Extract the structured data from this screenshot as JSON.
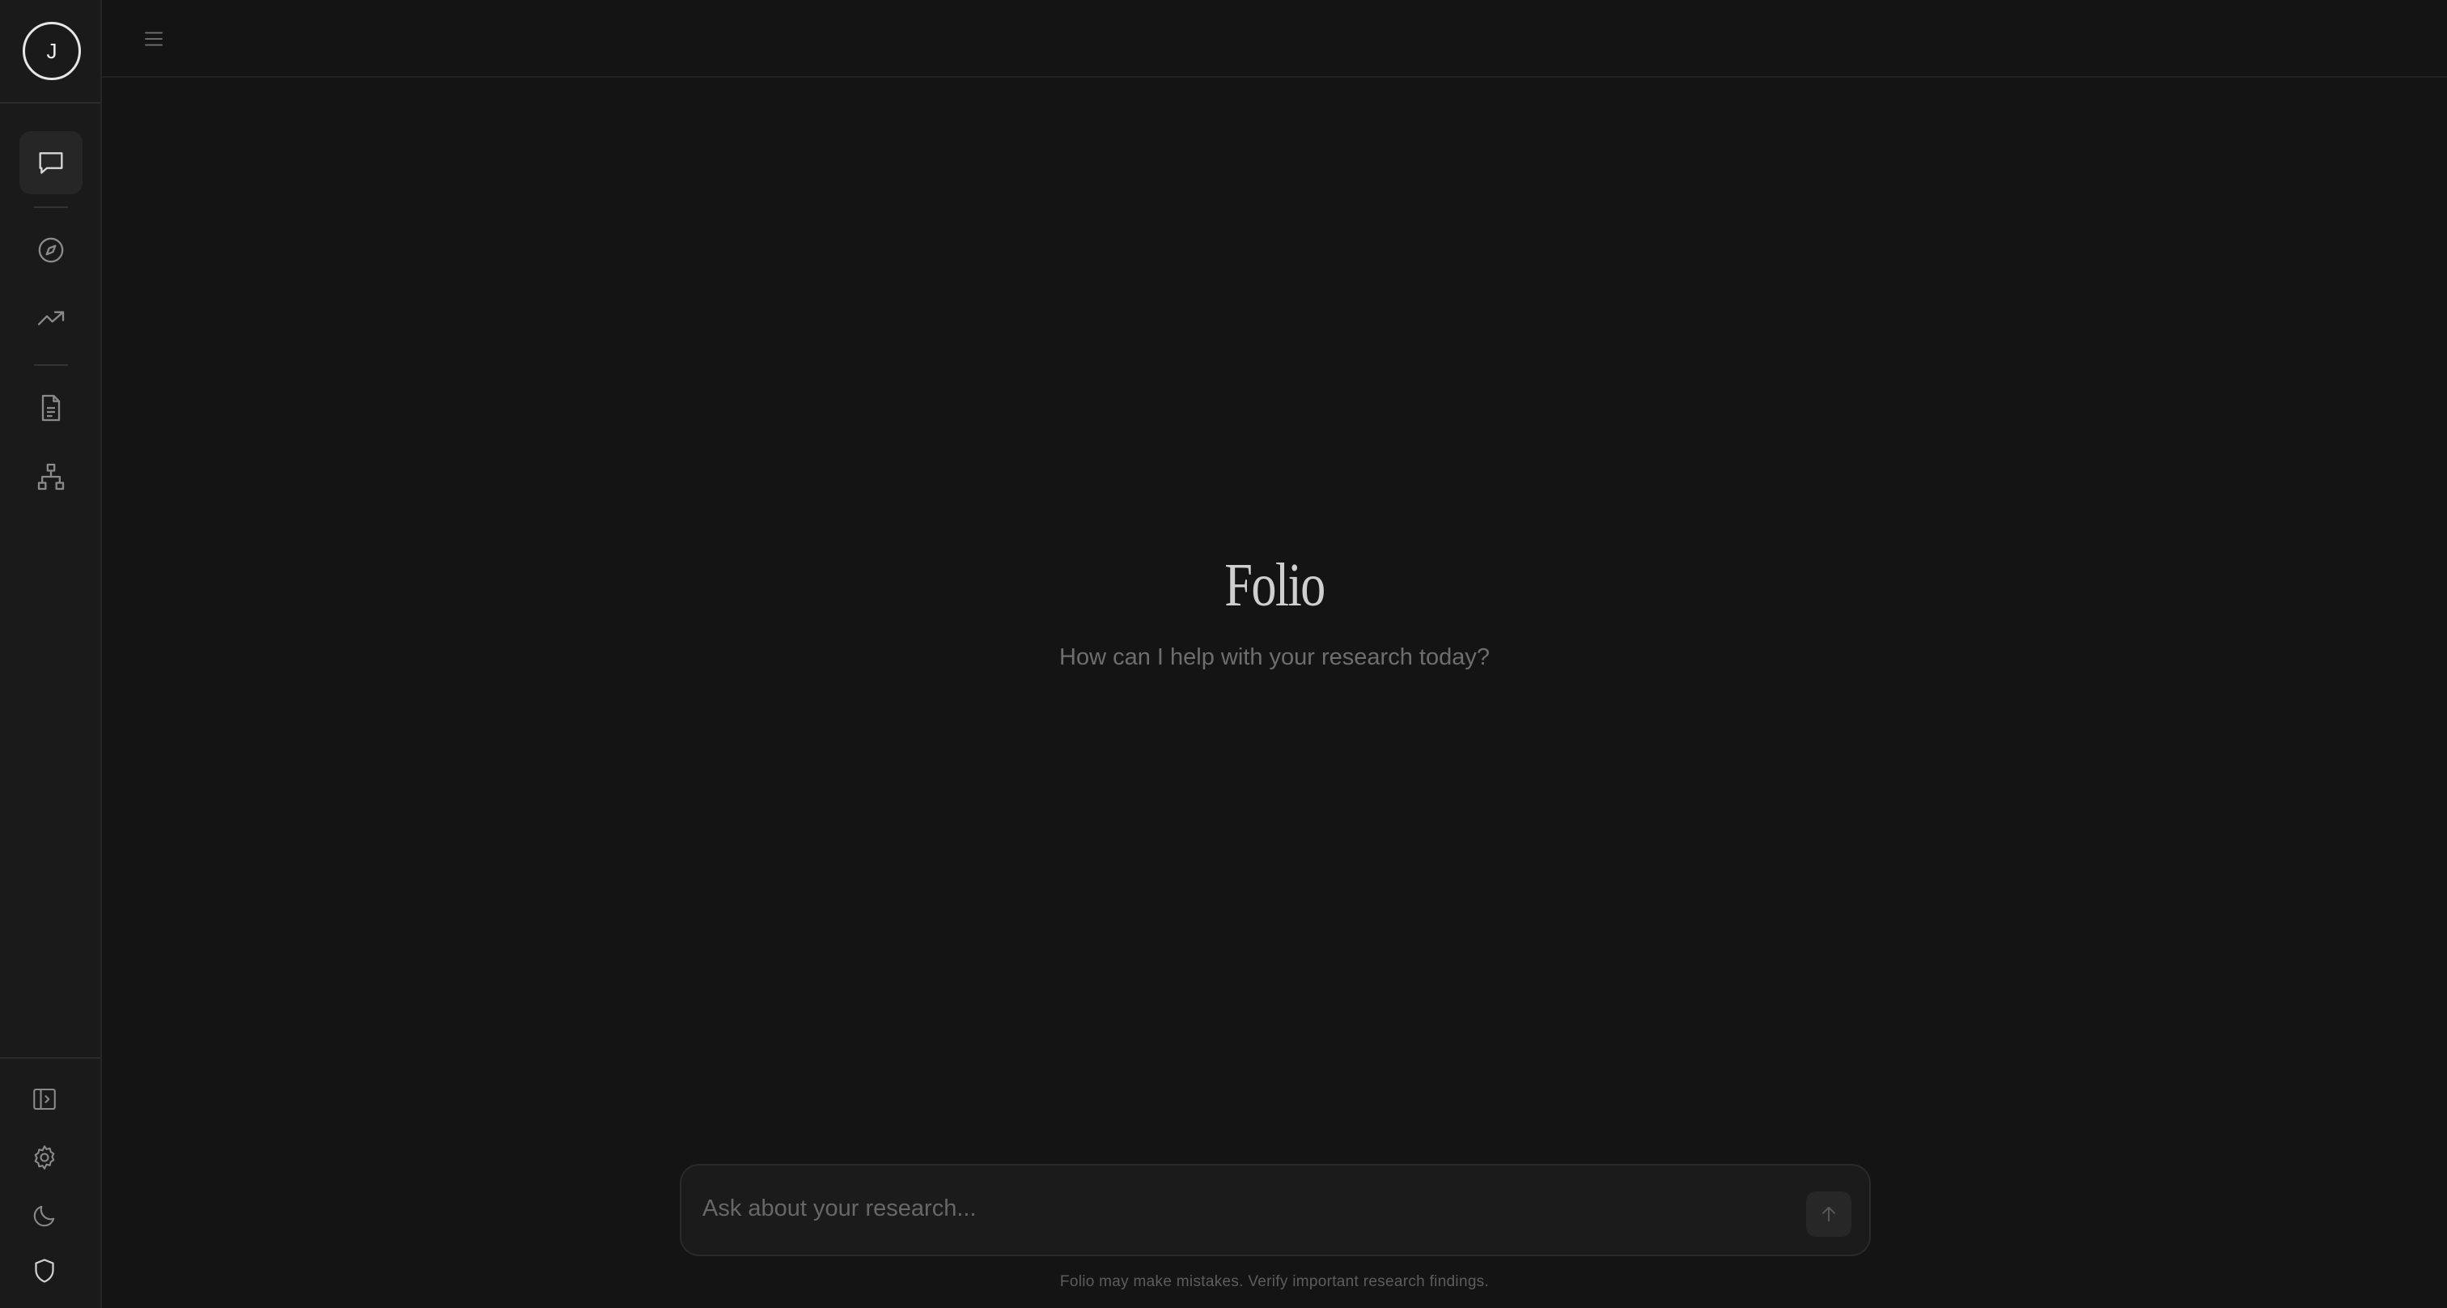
{
  "sidebar": {
    "avatar_initial": "J",
    "nav": [
      {
        "id": "chat",
        "icon": "chat-bubble-icon",
        "active": true
      },
      {
        "id": "explore",
        "icon": "compass-icon",
        "active": false
      },
      {
        "id": "trends",
        "icon": "trending-up-icon",
        "active": false
      },
      {
        "id": "documents",
        "icon": "document-icon",
        "active": false
      },
      {
        "id": "graph",
        "icon": "network-diagram-icon",
        "active": false
      }
    ],
    "bottom": [
      {
        "id": "toggle-panel",
        "icon": "sidebar-expand-icon"
      },
      {
        "id": "settings",
        "icon": "gear-icon"
      },
      {
        "id": "theme",
        "icon": "moon-icon"
      },
      {
        "id": "privacy",
        "icon": "shield-icon"
      }
    ]
  },
  "topbar": {
    "menu_icon": "hamburger-menu-icon"
  },
  "hero": {
    "title": "Folio",
    "subtitle": "How can I help with your research today?"
  },
  "composer": {
    "placeholder": "Ask about your research...",
    "value": "",
    "send_icon": "arrow-up-icon"
  },
  "footer": {
    "disclaimer": "Folio may make mistakes. Verify important research findings."
  },
  "colors": {
    "background": "#141414",
    "sidebar": "#1a1a1a",
    "active_nav": "#262626",
    "icon": "#8a8a8a"
  }
}
